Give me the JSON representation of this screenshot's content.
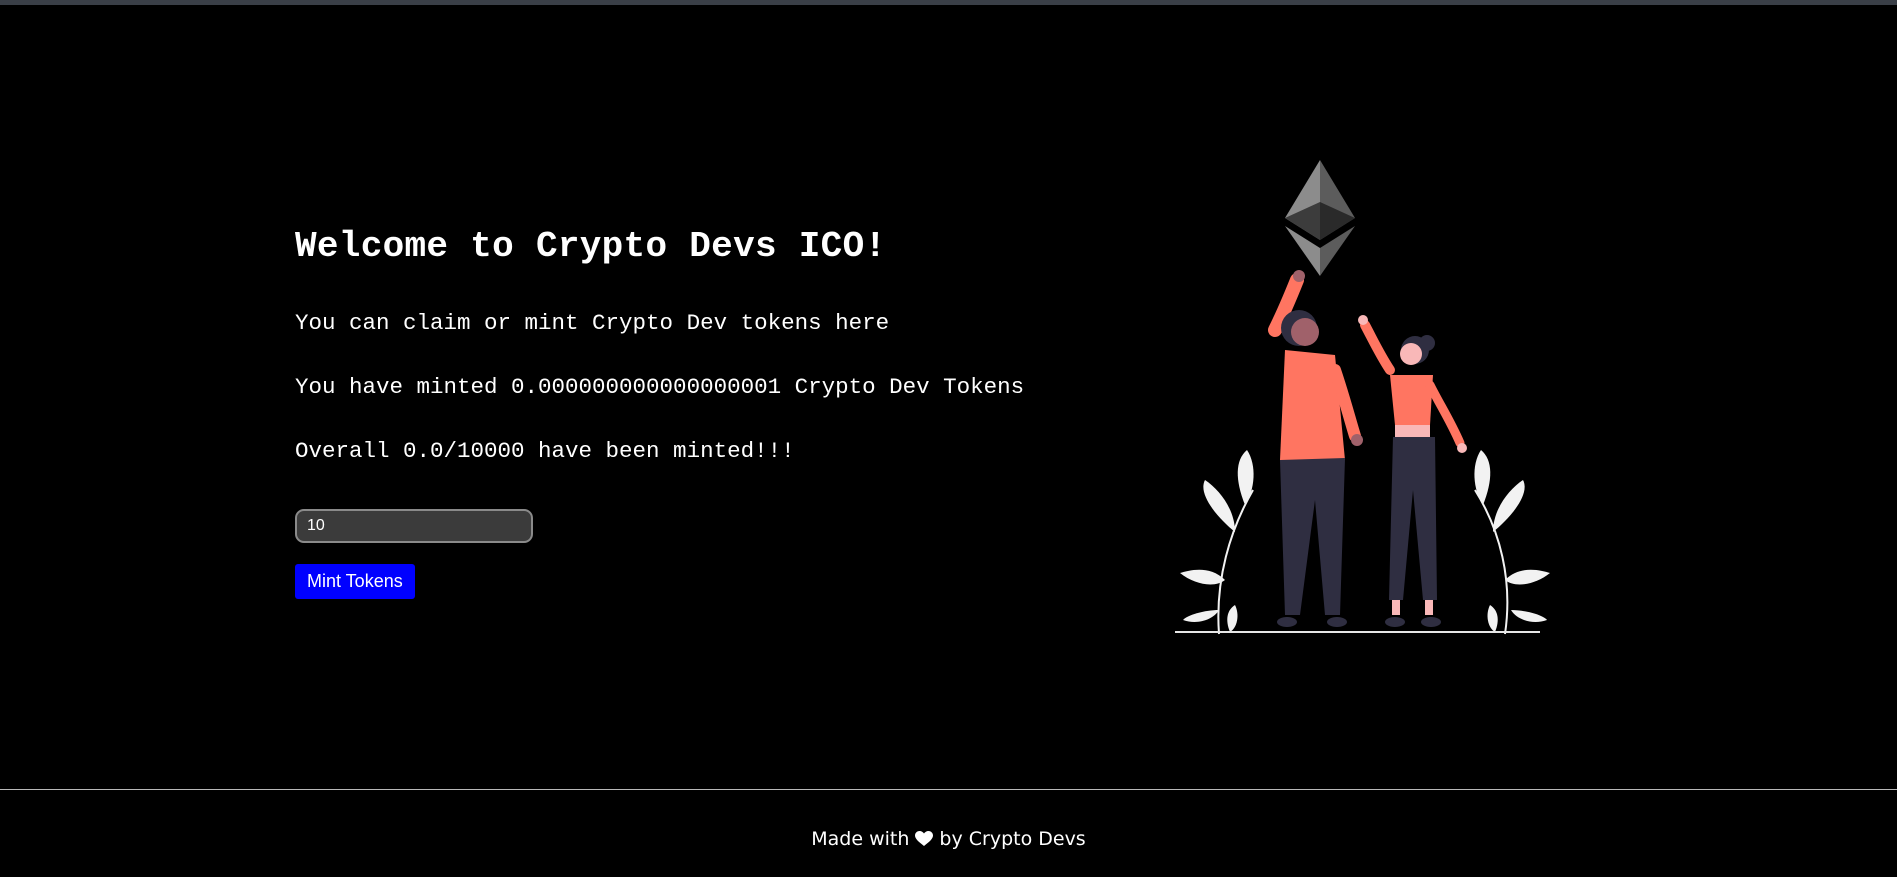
{
  "hero": {
    "title": "Welcome to Crypto Devs ICO!",
    "description_claim": "You can claim or mint Crypto Dev tokens here",
    "description_minted": "You have minted 0.000000000000000001 Crypto Dev Tokens",
    "description_overall": "Overall 0.0/10000 have been minted!!!"
  },
  "mint_form": {
    "amount_value": "10",
    "mint_button_label": "Mint Tokens"
  },
  "illustration": {
    "icons": [
      "ethereum-logo-icon",
      "person-cheering-icon",
      "plant-leaf-icon"
    ],
    "colors": {
      "shirt": "#ff7561",
      "pants": "#2f2e41",
      "leaves": "#f2f2f2",
      "skin": "#a0616a"
    }
  },
  "footer": {
    "prefix": "Made with",
    "heart_icon": "heart-icon",
    "suffix": "by Crypto Devs"
  },
  "colors": {
    "background": "#000000",
    "button_bg": "#0000ff",
    "text": "#ffffff"
  }
}
